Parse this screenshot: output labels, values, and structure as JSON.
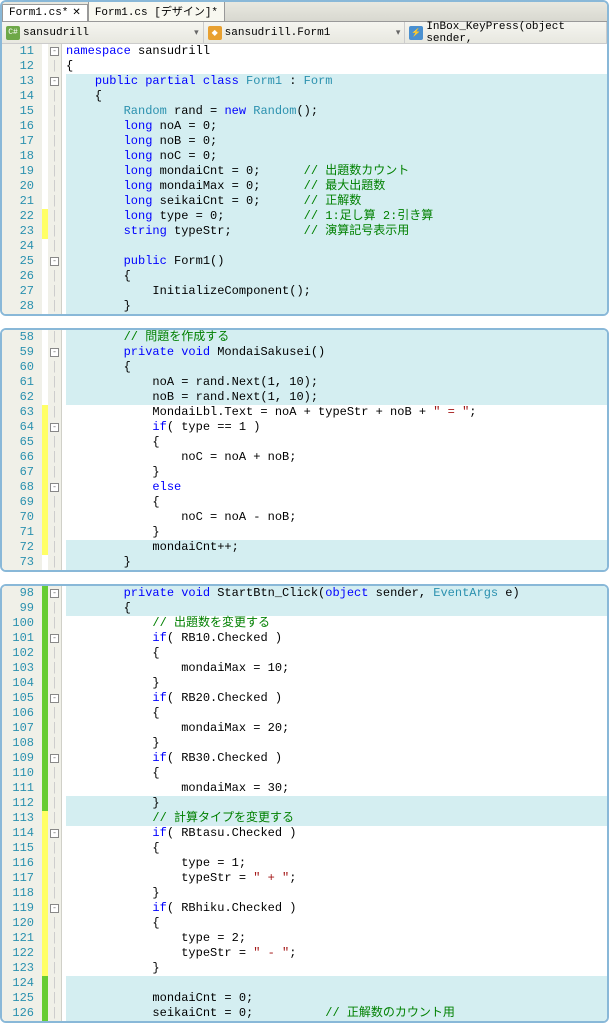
{
  "tabs": [
    {
      "label": "Form1.cs*",
      "active": true
    },
    {
      "label": "Form1.cs [デザイン]*",
      "active": false
    }
  ],
  "dropdowns": {
    "namespace": "sansudrill",
    "class": "sansudrill.Form1",
    "member": "InBox_KeyPress(object sender,"
  },
  "panel1": {
    "lines": [
      {
        "n": 11,
        "hl": false,
        "fold": "-",
        "ch": "",
        "txt": "<span class='kw'>namespace</span> sansudrill"
      },
      {
        "n": 12,
        "hl": false,
        "fold": "",
        "ch": "",
        "txt": "{"
      },
      {
        "n": 13,
        "hl": true,
        "fold": "-",
        "ch": "",
        "txt": "    <span class='kw'>public partial class</span> <span class='type'>Form1</span> : <span class='type'>Form</span>"
      },
      {
        "n": 14,
        "hl": true,
        "fold": "",
        "ch": "",
        "txt": "    {"
      },
      {
        "n": 15,
        "hl": true,
        "fold": "",
        "ch": "",
        "txt": "        <span class='type'>Random</span> rand = <span class='kw'>new</span> <span class='type'>Random</span>();"
      },
      {
        "n": 16,
        "hl": true,
        "fold": "",
        "ch": "",
        "txt": "        <span class='kw'>long</span> noA = 0;"
      },
      {
        "n": 17,
        "hl": true,
        "fold": "",
        "ch": "",
        "txt": "        <span class='kw'>long</span> noB = 0;"
      },
      {
        "n": 18,
        "hl": true,
        "fold": "",
        "ch": "",
        "txt": "        <span class='kw'>long</span> noC = 0;"
      },
      {
        "n": 19,
        "hl": true,
        "fold": "",
        "ch": "",
        "txt": "        <span class='kw'>long</span> mondaiCnt = 0;      <span class='cmt'>// 出題数カウント</span>"
      },
      {
        "n": 20,
        "hl": true,
        "fold": "",
        "ch": "",
        "txt": "        <span class='kw'>long</span> mondaiMax = 0;      <span class='cmt'>// 最大出題数</span>"
      },
      {
        "n": 21,
        "hl": true,
        "fold": "",
        "ch": "",
        "txt": "        <span class='kw'>long</span> seikaiCnt = 0;      <span class='cmt'>// 正解数</span>"
      },
      {
        "n": 22,
        "hl": true,
        "fold": "",
        "ch": "y",
        "txt": "        <span class='kw'>long</span> type = 0;           <span class='cmt'>// 1:足し算 2:引き算</span>"
      },
      {
        "n": 23,
        "hl": true,
        "fold": "",
        "ch": "y",
        "txt": "        <span class='kw'>string</span> typeStr;          <span class='cmt'>// 演算記号表示用</span>"
      },
      {
        "n": 24,
        "hl": true,
        "fold": "",
        "ch": "",
        "txt": ""
      },
      {
        "n": 25,
        "hl": true,
        "fold": "-",
        "ch": "",
        "txt": "        <span class='kw'>public</span> Form1()"
      },
      {
        "n": 26,
        "hl": true,
        "fold": "",
        "ch": "",
        "txt": "        {"
      },
      {
        "n": 27,
        "hl": true,
        "fold": "",
        "ch": "",
        "txt": "            InitializeComponent();"
      },
      {
        "n": 28,
        "hl": true,
        "fold": "",
        "ch": "",
        "txt": "        }"
      }
    ]
  },
  "panel2": {
    "lines": [
      {
        "n": 58,
        "hl": true,
        "fold": "",
        "ch": "",
        "txt": "        <span class='cmt'>// 問題を作成する</span>"
      },
      {
        "n": 59,
        "hl": true,
        "fold": "-",
        "ch": "",
        "txt": "        <span class='kw'>private void</span> MondaiSakusei()"
      },
      {
        "n": 60,
        "hl": true,
        "fold": "",
        "ch": "",
        "txt": "        {"
      },
      {
        "n": 61,
        "hl": true,
        "fold": "",
        "ch": "",
        "txt": "            noA = rand.Next(1, 10);"
      },
      {
        "n": 62,
        "hl": true,
        "fold": "",
        "ch": "",
        "txt": "            noB = rand.Next(1, 10);"
      },
      {
        "n": 63,
        "hl": false,
        "fold": "",
        "ch": "y",
        "txt": "            MondaiLbl.Text = noA + typeStr + noB + <span class='str'>\" = \"</span>;"
      },
      {
        "n": 64,
        "hl": false,
        "fold": "-",
        "ch": "y",
        "txt": "            <span class='kw'>if</span>( type == 1 )"
      },
      {
        "n": 65,
        "hl": false,
        "fold": "",
        "ch": "y",
        "txt": "            {"
      },
      {
        "n": 66,
        "hl": false,
        "fold": "",
        "ch": "y",
        "txt": "                noC = noA + noB;"
      },
      {
        "n": 67,
        "hl": false,
        "fold": "",
        "ch": "y",
        "txt": "            }"
      },
      {
        "n": 68,
        "hl": false,
        "fold": "-",
        "ch": "y",
        "txt": "            <span class='kw'>else</span>"
      },
      {
        "n": 69,
        "hl": false,
        "fold": "",
        "ch": "y",
        "txt": "            {"
      },
      {
        "n": 70,
        "hl": false,
        "fold": "",
        "ch": "y",
        "txt": "                noC = noA - noB;"
      },
      {
        "n": 71,
        "hl": false,
        "fold": "",
        "ch": "y",
        "txt": "            }"
      },
      {
        "n": 72,
        "hl": true,
        "fold": "",
        "ch": "y",
        "txt": "            mondaiCnt++;"
      },
      {
        "n": 73,
        "hl": true,
        "fold": "",
        "ch": "",
        "txt": "        }"
      }
    ]
  },
  "panel3": {
    "lines": [
      {
        "n": 98,
        "hl": true,
        "fold": "-",
        "ch": "g",
        "txt": "        <span class='kw'>private void</span> StartBtn_Click(<span class='kw'>object</span> sender, <span class='type'>EventArgs</span> e)"
      },
      {
        "n": 99,
        "hl": true,
        "fold": "",
        "ch": "g",
        "txt": "        {"
      },
      {
        "n": 100,
        "hl": false,
        "fold": "",
        "ch": "g",
        "txt": "            <span class='cmt'>// 出題数を変更する</span>"
      },
      {
        "n": 101,
        "hl": false,
        "fold": "-",
        "ch": "g",
        "txt": "            <span class='kw'>if</span>( RB10.Checked )"
      },
      {
        "n": 102,
        "hl": false,
        "fold": "",
        "ch": "g",
        "txt": "            {"
      },
      {
        "n": 103,
        "hl": false,
        "fold": "",
        "ch": "g",
        "txt": "                mondaiMax = 10;"
      },
      {
        "n": 104,
        "hl": false,
        "fold": "",
        "ch": "g",
        "txt": "            }"
      },
      {
        "n": 105,
        "hl": false,
        "fold": "-",
        "ch": "g",
        "txt": "            <span class='kw'>if</span>( RB20.Checked )"
      },
      {
        "n": 106,
        "hl": false,
        "fold": "",
        "ch": "g",
        "txt": "            {"
      },
      {
        "n": 107,
        "hl": false,
        "fold": "",
        "ch": "g",
        "txt": "                mondaiMax = 20;"
      },
      {
        "n": 108,
        "hl": false,
        "fold": "",
        "ch": "g",
        "txt": "            }"
      },
      {
        "n": 109,
        "hl": false,
        "fold": "-",
        "ch": "g",
        "txt": "            <span class='kw'>if</span>( RB30.Checked )"
      },
      {
        "n": 110,
        "hl": false,
        "fold": "",
        "ch": "g",
        "txt": "            {"
      },
      {
        "n": 111,
        "hl": false,
        "fold": "",
        "ch": "g",
        "txt": "                mondaiMax = 30;"
      },
      {
        "n": 112,
        "hl": true,
        "fold": "",
        "ch": "g",
        "txt": "            }"
      },
      {
        "n": 113,
        "hl": true,
        "fold": "",
        "ch": "y",
        "txt": "            <span class='cmt'>// 計算タイプを変更する</span>"
      },
      {
        "n": 114,
        "hl": false,
        "fold": "-",
        "ch": "y",
        "txt": "            <span class='kw'>if</span>( RBtasu.Checked )"
      },
      {
        "n": 115,
        "hl": false,
        "fold": "",
        "ch": "y",
        "txt": "            {"
      },
      {
        "n": 116,
        "hl": false,
        "fold": "",
        "ch": "y",
        "txt": "                type = 1;"
      },
      {
        "n": 117,
        "hl": false,
        "fold": "",
        "ch": "y",
        "txt": "                typeStr = <span class='str'>\" + \"</span>;"
      },
      {
        "n": 118,
        "hl": false,
        "fold": "",
        "ch": "y",
        "txt": "            }"
      },
      {
        "n": 119,
        "hl": false,
        "fold": "-",
        "ch": "y",
        "txt": "            <span class='kw'>if</span>( RBhiku.Checked )"
      },
      {
        "n": 120,
        "hl": false,
        "fold": "",
        "ch": "y",
        "txt": "            {"
      },
      {
        "n": 121,
        "hl": false,
        "fold": "",
        "ch": "y",
        "txt": "                type = 2;"
      },
      {
        "n": 122,
        "hl": false,
        "fold": "",
        "ch": "y",
        "txt": "                typeStr = <span class='str'>\" - \"</span>;"
      },
      {
        "n": 123,
        "hl": false,
        "fold": "",
        "ch": "y",
        "txt": "            }"
      },
      {
        "n": 124,
        "hl": true,
        "fold": "",
        "ch": "g",
        "txt": ""
      },
      {
        "n": 125,
        "hl": true,
        "fold": "",
        "ch": "g",
        "txt": "            mondaiCnt = 0;"
      },
      {
        "n": 126,
        "hl": true,
        "fold": "",
        "ch": "g",
        "txt": "            seikaiCnt = 0;          <span class='cmt'>// 正解数のカウント用</span>"
      }
    ]
  }
}
